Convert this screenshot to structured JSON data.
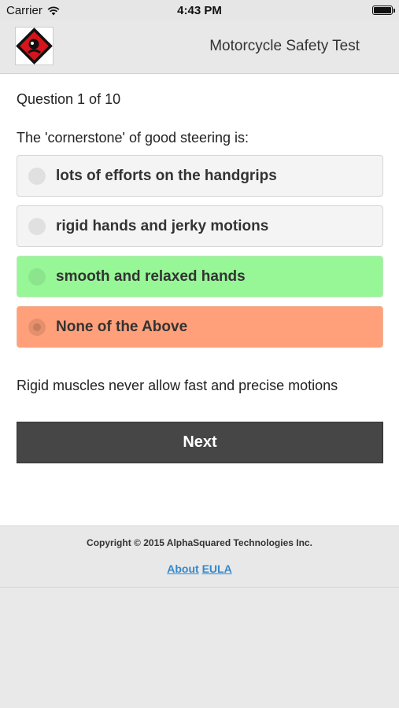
{
  "status_bar": {
    "carrier": "Carrier",
    "time": "4:43 PM",
    "icons": [
      "wifi-icon",
      "battery-icon"
    ]
  },
  "header": {
    "title": "Motorcycle Safety Test",
    "logo": "app-logo"
  },
  "quiz": {
    "counter": "Question 1 of 10",
    "question": "The 'cornerstone' of good steering is:",
    "options": [
      {
        "label": "lots of efforts on the handgrips",
        "state": "neutral"
      },
      {
        "label": "rigid hands and jerky motions",
        "state": "neutral"
      },
      {
        "label": "smooth and relaxed hands",
        "state": "correct"
      },
      {
        "label": "None of the Above",
        "state": "selected-wrong"
      }
    ],
    "explanation": "Rigid muscles never allow fast and precise motions",
    "next_label": "Next"
  },
  "colors": {
    "correct": "#97f797",
    "wrong": "#ffa07a",
    "button": "#454645",
    "link": "#3388cc"
  },
  "footer": {
    "copyright": "Copyright © 2015 AlphaSquared Technologies Inc.",
    "links": {
      "about": "About",
      "eula": "EULA"
    }
  }
}
